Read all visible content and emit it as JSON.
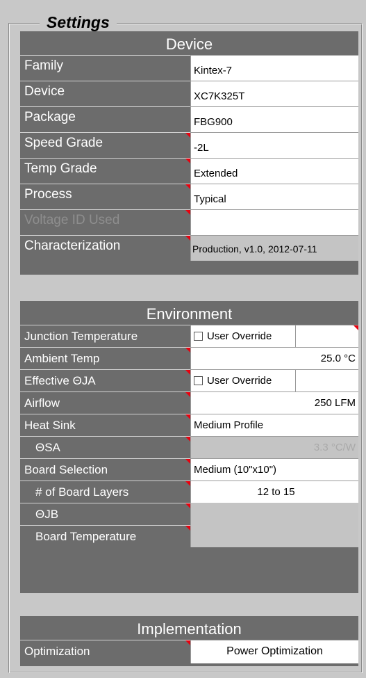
{
  "title": "Settings",
  "device": {
    "header": "Device",
    "rows": [
      {
        "label": "Family",
        "value": "Kintex-7"
      },
      {
        "label": "Device",
        "value": "XC7K325T"
      },
      {
        "label": "Package",
        "value": "FBG900"
      },
      {
        "label": "Speed Grade",
        "value": "-2L"
      },
      {
        "label": "Temp Grade",
        "value": "Extended"
      },
      {
        "label": "Process",
        "value": "Typical"
      },
      {
        "label": "Voltage ID Used",
        "value": ""
      },
      {
        "label": "Characterization",
        "value": "Production, v1.0, 2012-07-11"
      }
    ]
  },
  "environment": {
    "header": "Environment",
    "junction": {
      "label": "Junction Temperature",
      "checkbox": "User Override"
    },
    "ambient": {
      "label": "Ambient Temp",
      "value": "25.0 °C"
    },
    "theta_ja": {
      "label": "Effective ΘJA",
      "checkbox": "User Override"
    },
    "airflow": {
      "label": "Airflow",
      "value": "250 LFM"
    },
    "heat_sink": {
      "label": "Heat Sink",
      "value": "Medium Profile"
    },
    "theta_sa": {
      "label": "ΘSA",
      "value": "3.3 °C/W"
    },
    "board_selection": {
      "label": "Board Selection",
      "value": "Medium (10\"x10\")"
    },
    "board_layers": {
      "label": "# of Board Layers",
      "value": "12 to 15"
    },
    "theta_jb": {
      "label": "ΘJB",
      "value": ""
    },
    "board_temp": {
      "label": "Board Temperature",
      "value": ""
    }
  },
  "implementation": {
    "header": "Implementation",
    "optimization": {
      "label": "Optimization",
      "value": "Power Optimization"
    }
  },
  "colors": {
    "panel_bg": "#c8c8c8",
    "header_bg": "#6c6c6c",
    "flag": "#e8000e"
  }
}
